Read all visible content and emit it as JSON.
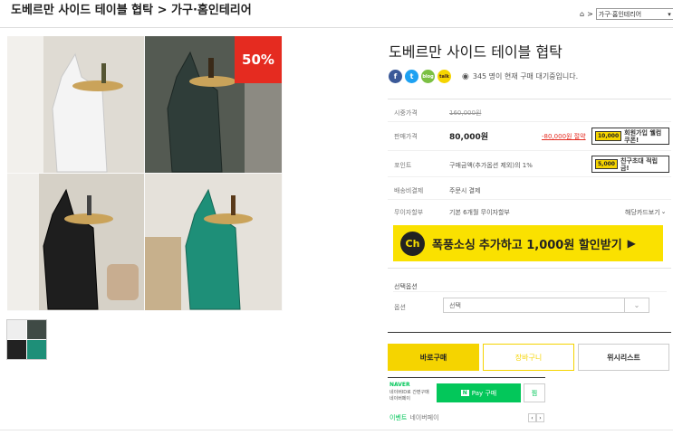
{
  "header": {
    "page_title": "도베르만 사이드 테이블 협탁 > 가구·홈인테리어"
  },
  "breadcrumb": {
    "home_icon": "home-icon",
    "separator": ">",
    "category": "가구·홈인테리어"
  },
  "product": {
    "name": "도베르만 사이드 테이블 협탁",
    "discount_badge": "50%",
    "viewers_text": "345 명이 현재 구매 대기중입니다.",
    "rows": {
      "retail_label": "시중가격",
      "retail_value": "160,000원",
      "sale_label": "판매가격",
      "sale_value": "80,000원",
      "sale_saving": "-80,000원 절약",
      "point_label": "포인트",
      "point_value": "구매금액(추가옵션 제외)의 1%",
      "shipping_label": "배송비결제",
      "shipping_value": "주문시 결제",
      "installment_label": "무이자할부",
      "installment_value": "기본 6개월 무이자할부",
      "installment_link": "해당카드보기"
    }
  },
  "coupons": {
    "member_chip": "10,000",
    "member_text": "회원가입 웰컴쿠폰!",
    "friend_chip": "5,000",
    "friend_text": "친구초대 적립금!"
  },
  "share": {
    "facebook": "f",
    "twitter": "t",
    "blog": "blog",
    "kakao": "talk"
  },
  "channel_banner": {
    "logo": "Ch",
    "highlight": "폭풍소싱",
    "text": "추가하고 1,000원 할인받기",
    "arrow": "▶"
  },
  "options": {
    "section_label": "선택옵션",
    "option_label": "옵션",
    "select_value": "선택"
  },
  "buttons": {
    "buy_now": "바로구매",
    "cart": "장바구니",
    "wishlist": "위시리스트"
  },
  "npay": {
    "brand": "NAVER",
    "desc_line1": "네이버ID로 간편구매",
    "desc_line2": "네이버페이",
    "pay_button": "Pay 구매",
    "wish_button": "찜",
    "event_label": "이벤트",
    "event_text": "네이버페이"
  },
  "colors": {
    "accent_yellow": "#f5d400",
    "badge_red": "#e52b20",
    "npay_green": "#03c75a",
    "banner_yellow": "#fae100"
  }
}
